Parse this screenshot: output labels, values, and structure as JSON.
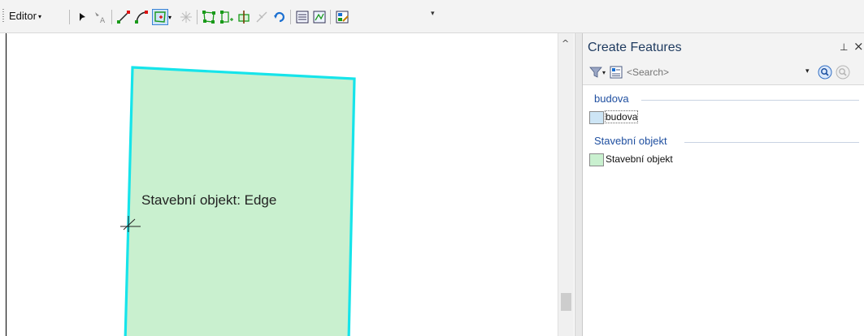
{
  "toolbar": {
    "editor_menu_label": "Editor",
    "editor_menu_arrow": "▾",
    "overflow_glyph": "▾"
  },
  "map": {
    "feature_label": "Stavební objekt: Edge",
    "polygon_fill": "#c9f0cf",
    "polygon_outline": "#16e4ea"
  },
  "panel": {
    "title": "Create Features",
    "pin_glyph": "⊥",
    "close_glyph": "×",
    "search_placeholder": "<Search>",
    "groups": [
      {
        "header": "budova",
        "templates": [
          {
            "label": "budova",
            "swatch": "#cde5f5"
          }
        ]
      },
      {
        "header": "Stavební objekt",
        "templates": [
          {
            "label": "Stavební objekt",
            "swatch": "#c9f0cf"
          }
        ]
      }
    ]
  },
  "scrollbar": {
    "up_glyph": "^"
  }
}
